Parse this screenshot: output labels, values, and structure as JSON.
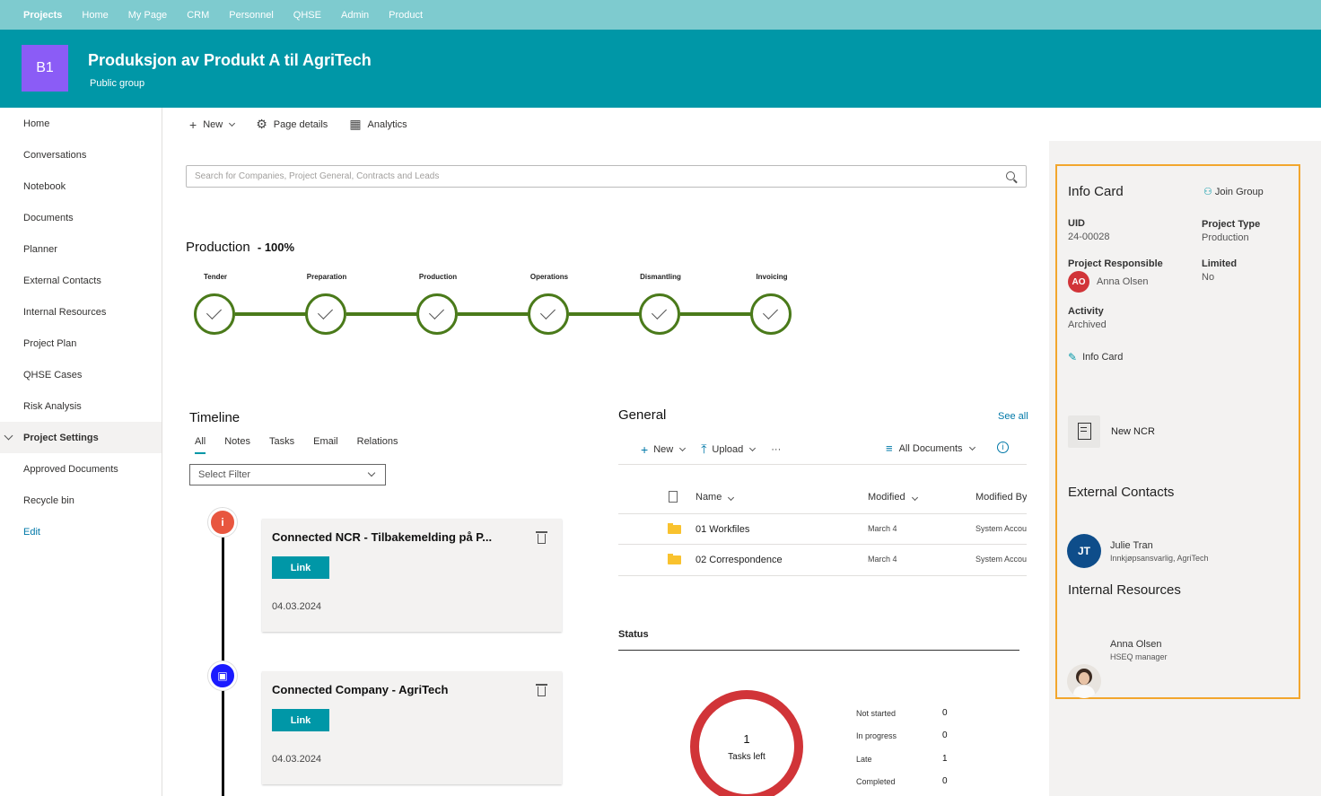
{
  "topnav": [
    "Projects",
    "Home",
    "My Page",
    "CRM",
    "Personnel",
    "QHSE",
    "Admin",
    "Product"
  ],
  "header": {
    "logo": "B1",
    "title": "Produksjon av Produkt A til AgriTech",
    "subtitle": "Public group"
  },
  "sidebar": {
    "items": [
      "Home",
      "Conversations",
      "Notebook",
      "Documents",
      "Planner",
      "External Contacts",
      "Internal Resources",
      "Project Plan",
      "QHSE Cases",
      "Risk Analysis",
      "Project Settings",
      "Approved Documents",
      "Recycle bin",
      "Edit"
    ],
    "selected": "Project Settings"
  },
  "commandbar": {
    "new": "New",
    "page_details": "Page details",
    "analytics": "Analytics"
  },
  "search": {
    "placeholder": "Search for Companies, Project General, Contracts and Leads"
  },
  "production": {
    "title": "Production",
    "percent": "- 100%",
    "stages": [
      "Tender",
      "Preparation",
      "Production",
      "Operations",
      "Dismantling",
      "Invoicing"
    ],
    "accent": "#4a7a1a"
  },
  "timeline": {
    "title": "Timeline",
    "tabs": [
      "All",
      "Notes",
      "Tasks",
      "Email",
      "Relations"
    ],
    "filter": "Select Filter",
    "cards": [
      {
        "title": "Connected NCR - Tilbakemelding på P...",
        "button": "Link",
        "date": "04.03.2024",
        "icon": "info-icon",
        "color": "#e8563f"
      },
      {
        "title": "Connected Company - AgriTech",
        "button": "Link",
        "date": "04.03.2024",
        "icon": "briefcase-icon",
        "color": "#1a1aff"
      }
    ]
  },
  "general": {
    "title": "General",
    "see_all": "See all",
    "new": "New",
    "upload": "Upload",
    "more": "···",
    "view": "All Documents",
    "columns": {
      "name": "Name",
      "modified": "Modified",
      "modified_by": "Modified By"
    },
    "rows": [
      {
        "name": "01 Workfiles",
        "modified": "March 4",
        "modified_by": "System Account"
      },
      {
        "name": "02 Correspondence",
        "modified": "March 4",
        "modified_by": "System Account"
      }
    ]
  },
  "status": {
    "title": "Status",
    "tasks_left": "1",
    "tasks_left_label": "Tasks left",
    "items": [
      {
        "label": "Not started",
        "value": "0"
      },
      {
        "label": "In progress",
        "value": "0"
      },
      {
        "label": "Late",
        "value": "1"
      },
      {
        "label": "Completed",
        "value": "0"
      }
    ],
    "color": "#d13438"
  },
  "infocard": {
    "title": "Info Card",
    "join": "Join Group",
    "uid_label": "UID",
    "uid": "24-00028",
    "type_label": "Project Type",
    "type": "Production",
    "resp_label": "Project Responsible",
    "resp_initials": "AO",
    "resp_name": "Anna Olsen",
    "limited_label": "Limited",
    "limited": "No",
    "activity_label": "Activity",
    "activity": "Archived",
    "edit_link": "Info Card",
    "ncr": "New NCR",
    "ext_title": "External Contacts",
    "ext_initials": "JT",
    "ext_name": "Julie Tran",
    "ext_role": "Innkjøpsansvarlig, AgriTech",
    "int_title": "Internal Resources",
    "int_name": "Anna Olsen",
    "int_role": "HSEQ manager",
    "border_color": "#f2a62d"
  }
}
